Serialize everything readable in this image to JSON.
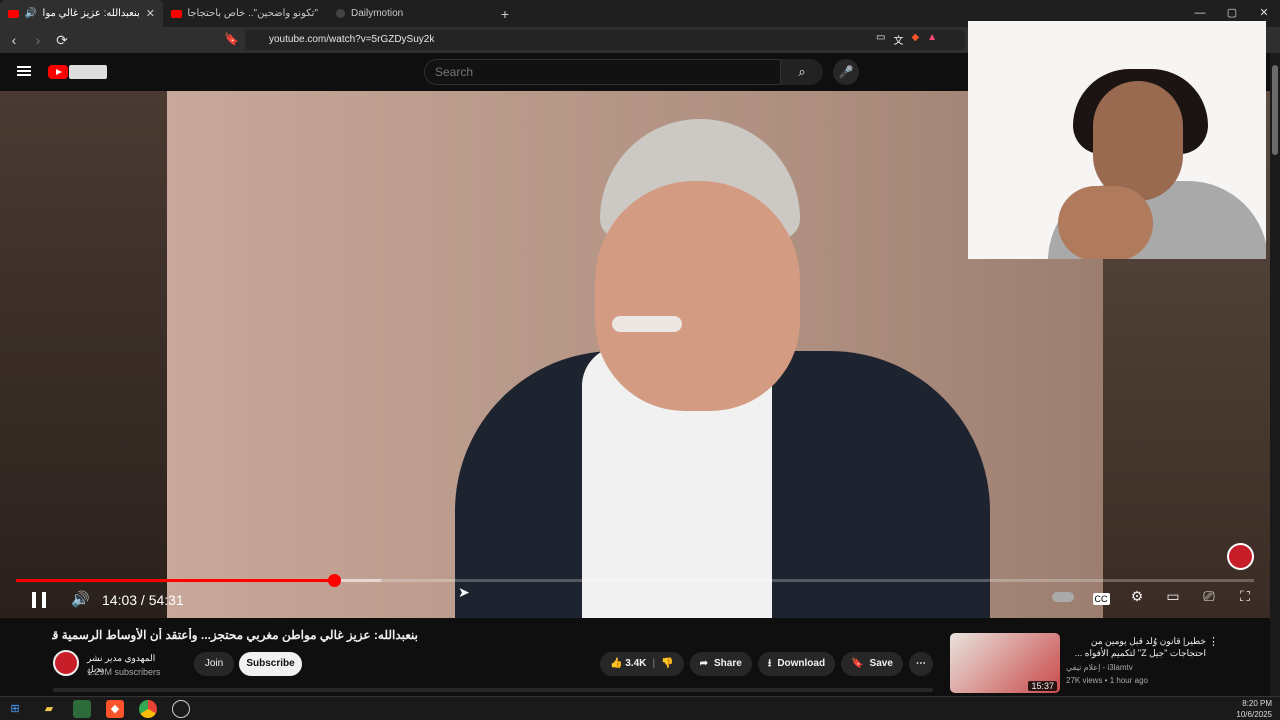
{
  "browser": {
    "tabs": [
      {
        "label": "بنعبدالله: عزيز غالي مواطن مغ...",
        "active": true
      },
      {
        "label": "\"تكونو واضحين\".. خاص باحتجاجات الشـ",
        "active": false
      },
      {
        "label": "Dailymotion",
        "active": false
      }
    ],
    "new_tab": "+",
    "url": "youtube.com/watch?v=5rGZDySuy2k",
    "controls": {
      "minimize": "—",
      "maximize": "▢",
      "close": "✕"
    }
  },
  "youtube": {
    "search_placeholder": "Search",
    "player": {
      "current_time": "14:03",
      "duration": "54:31",
      "time_display": "14:03 / 54:31",
      "progress_fraction": 0.257,
      "buffered_fraction": 0.295
    },
    "video": {
      "title": "بنعبدالله: عزيز غالي مواطن مغربي محتجز... وأعتقد أن الأوساط الرسمية قامت بعملها",
      "channel_name": "المهدوي مدير نشر بديل",
      "subscribers": "1.29M subscribers",
      "join_label": "Join",
      "subscribe_label": "Subscribe",
      "likes": "3.4K",
      "share_label": "Share",
      "download_label": "Download",
      "save_label": "Save"
    },
    "recommended": {
      "title": "خطير| قانون وُلد قبل يومين من احتجاجات \"جيل Z\" لتكميم الأفواه ... هذه المطالب التي...",
      "channel": "إعلام تيفي - i3lamtv",
      "views_time": "27K views • 1 hour ago",
      "duration": "15:37"
    }
  },
  "taskbar": {
    "time": "8:20 PM",
    "date": "10/6/2025"
  },
  "colors": {
    "accent": "#ff0000",
    "background": "#0f0f0f"
  }
}
